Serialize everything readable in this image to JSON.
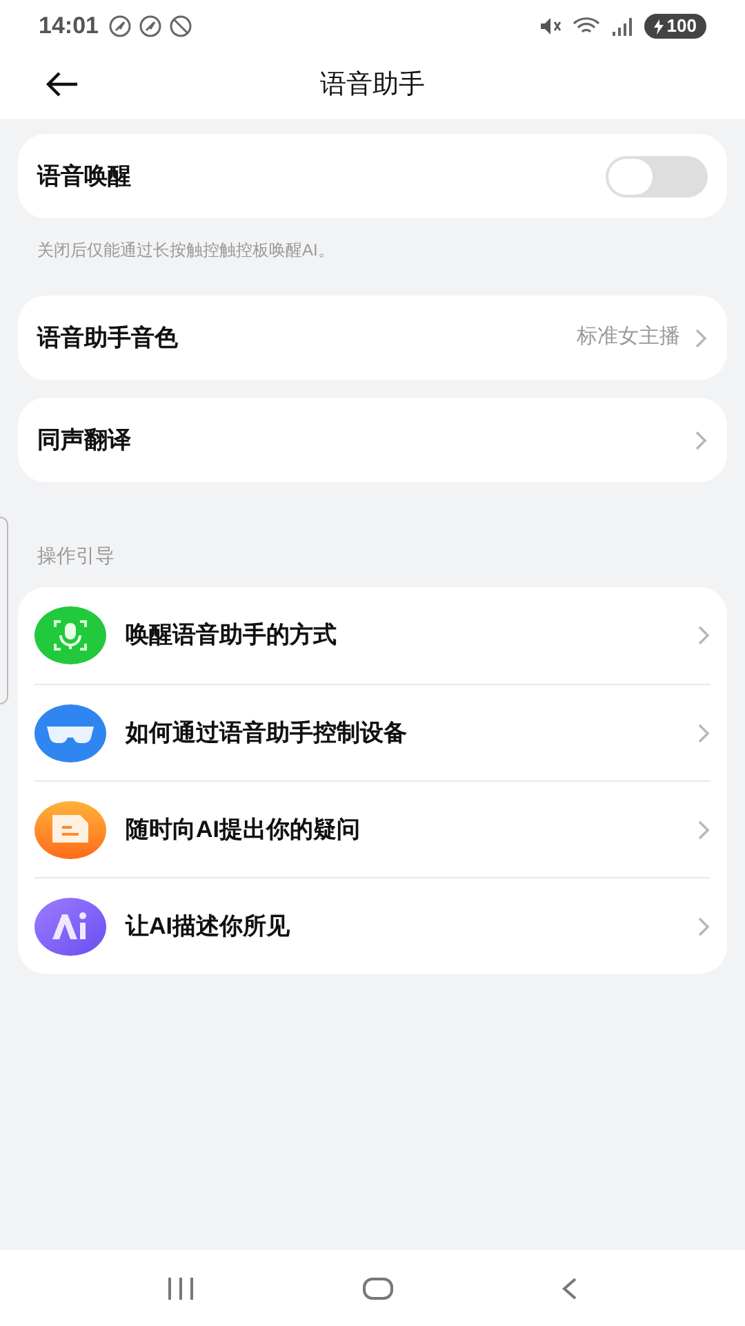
{
  "status_bar": {
    "time": "14:01",
    "battery": "100"
  },
  "header": {
    "title": "语音助手"
  },
  "wake_setting": {
    "label": "语音唤醒",
    "on": false,
    "hint": "关闭后仅能通过长按触控触控板唤醒AI。"
  },
  "settings": [
    {
      "label": "语音助手音色",
      "value": "标准女主播"
    },
    {
      "label": "同声翻译"
    }
  ],
  "guide": {
    "title": "操作引导",
    "items": [
      {
        "kind": "wake",
        "label": "唤醒语音助手的方式"
      },
      {
        "kind": "glasses",
        "label": "如何通过语音助手控制设备"
      },
      {
        "kind": "ask",
        "label": "随时向AI提出你的疑问"
      },
      {
        "kind": "describe",
        "label": "让AI描述你所见"
      }
    ]
  }
}
